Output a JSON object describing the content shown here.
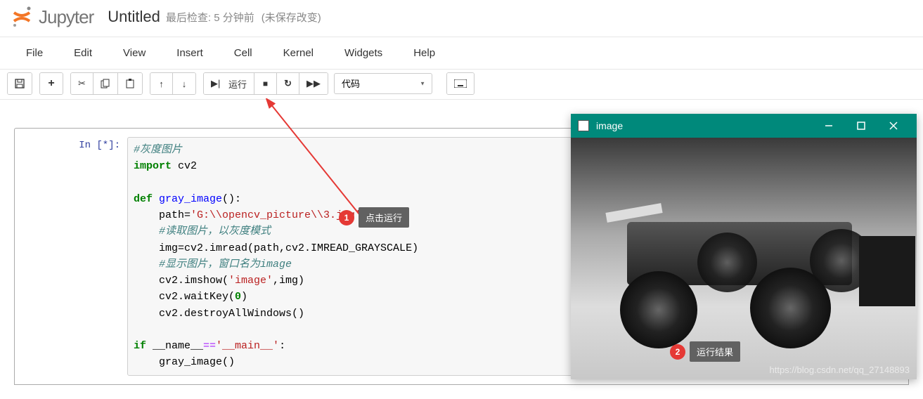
{
  "header": {
    "logo_text": "Jupyter",
    "notebook_name": "Untitled",
    "checkpoint": "最后检查: 5 分钟前",
    "unsaved": "(未保存改变)"
  },
  "menubar": [
    "File",
    "Edit",
    "View",
    "Insert",
    "Cell",
    "Kernel",
    "Widgets",
    "Help"
  ],
  "toolbar": {
    "run_label": "运行",
    "cell_type": "代码"
  },
  "cell": {
    "prompt": "In  [*]:",
    "code": {
      "l1": "#灰度图片",
      "l2a": "import",
      "l2b": " cv2",
      "l3a": "def",
      "l3b": " ",
      "l3c": "gray_image",
      "l3d": "():",
      "l4a": "    path=",
      "l4b": "'G:\\\\opencv_picture\\\\3.jpg'",
      "l5": "    #读取图片，以灰度模式",
      "l6": "    img=cv2.imread(path,cv2.IMREAD_GRAYSCALE)",
      "l7": "    #显示图片，窗口名为image",
      "l8a": "    cv2.imshow(",
      "l8b": "'image'",
      "l8c": ",img)",
      "l9a": "    cv2.waitKey(",
      "l9b": "0",
      "l9c": ")",
      "l10": "    cv2.destroyAllWindows()",
      "l11a": "if",
      "l11b": " __name__",
      "l11c": "==",
      "l11d": "'__main__'",
      "l11e": ":",
      "l12": "    gray_image()"
    }
  },
  "image_window": {
    "title": "image",
    "watermark": "https://blog.csdn.net/qq_27148893"
  },
  "annotations": {
    "a1_num": "1",
    "a1_label": "点击运行",
    "a2_num": "2",
    "a2_label": "运行结果"
  }
}
